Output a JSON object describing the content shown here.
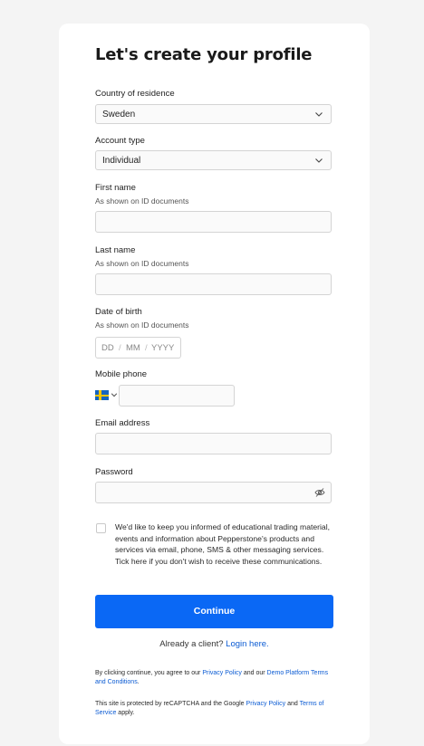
{
  "form": {
    "title": "Let's create your profile",
    "country": {
      "label": "Country of residence",
      "value": "Sweden"
    },
    "account_type": {
      "label": "Account type",
      "value": "Individual"
    },
    "first_name": {
      "label": "First name",
      "hint": "As shown on ID documents",
      "value": ""
    },
    "last_name": {
      "label": "Last name",
      "hint": "As shown on ID documents",
      "value": ""
    },
    "dob": {
      "label": "Date of birth",
      "hint": "As shown on ID documents",
      "dd": "DD",
      "mm": "MM",
      "yyyy": "YYYY",
      "sep": "/"
    },
    "mobile": {
      "label": "Mobile phone",
      "flag": "sweden-flag-icon",
      "value": ""
    },
    "email": {
      "label": "Email address",
      "value": ""
    },
    "password": {
      "label": "Password",
      "value": ""
    },
    "consent": {
      "checked": false,
      "text": "We'd like to keep you informed of educational trading material, events and information about Pepperstone's products and services via email, phone, SMS & other messaging services. Tick here if you don't wish to receive these communications."
    },
    "continue_label": "Continue",
    "already": {
      "text": "Already a client?",
      "link": "Login here."
    },
    "legal1": {
      "prefix": "By clicking continue, you agree to our",
      "privacy": "Privacy Policy",
      "middle": "and our",
      "demo": "Demo Platform Terms and Conditions",
      "suffix": "."
    },
    "legal2": {
      "prefix": "This site is protected by reCAPTCHA and the Google",
      "privacy": "Privacy Policy",
      "middle": "and",
      "terms": "Terms of Service",
      "suffix": "apply."
    }
  },
  "colors": {
    "accent": "#0a68f5",
    "link": "#0b5bd3",
    "background": "#f4f4f4",
    "card": "#ffffff"
  }
}
